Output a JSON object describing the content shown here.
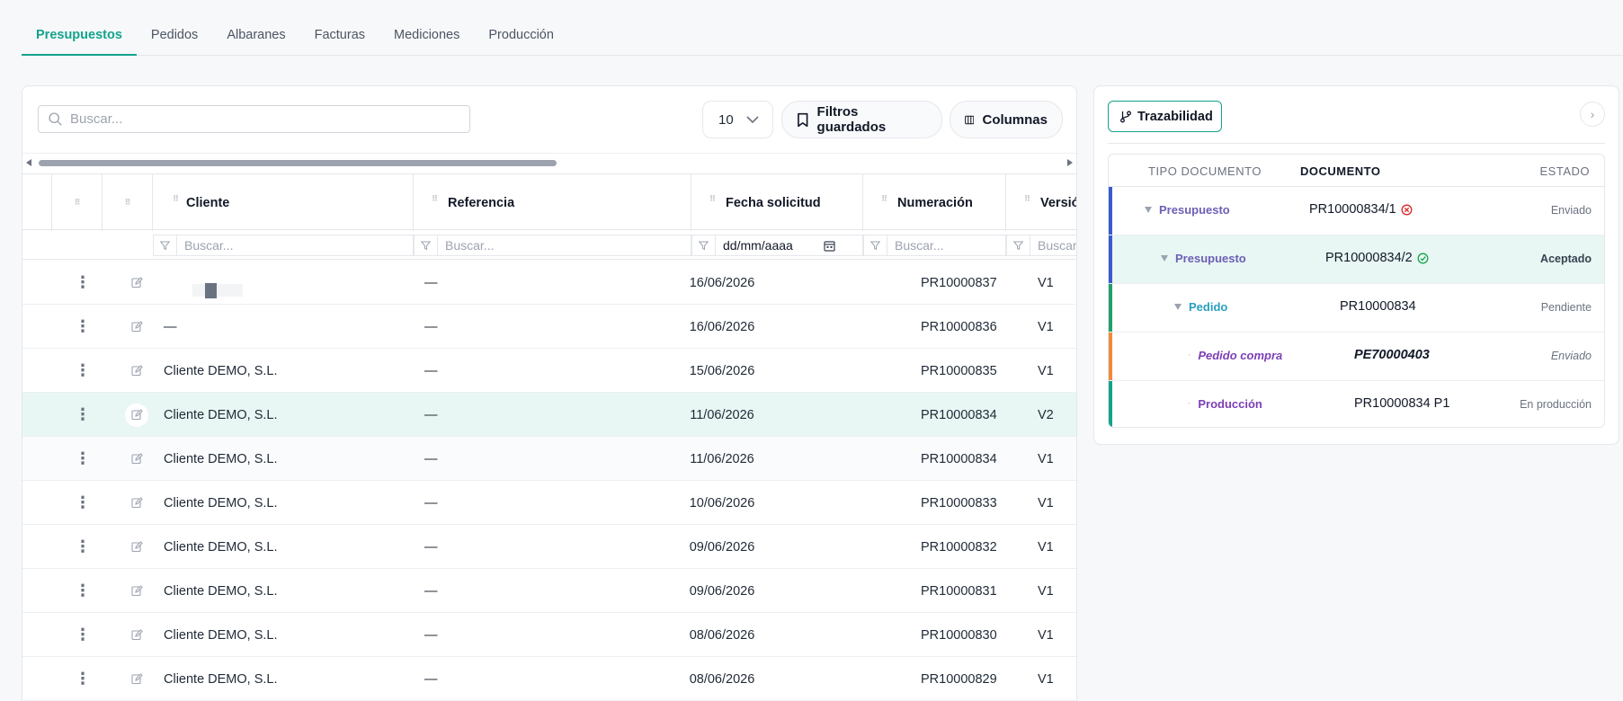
{
  "tabs": [
    {
      "label": "Presupuestos",
      "active": true
    },
    {
      "label": "Pedidos"
    },
    {
      "label": "Albaranes"
    },
    {
      "label": "Facturas"
    },
    {
      "label": "Mediciones"
    },
    {
      "label": "Producción"
    }
  ],
  "toolbar": {
    "search_placeholder": "Buscar...",
    "page_size": "10",
    "saved_filters_label": "Filtros guardados",
    "columns_label": "Columnas"
  },
  "table": {
    "headers": {
      "cliente": "Cliente",
      "referencia": "Referencia",
      "fecha": "Fecha solicitud",
      "numeracion": "Numeración",
      "version": "Versión"
    },
    "filters": {
      "cliente": "Buscar...",
      "referencia": "Buscar...",
      "fecha": "dd/mm/aaaa",
      "numeracion": "Buscar...",
      "version": "Buscar..."
    },
    "rows": [
      {
        "cliente": "",
        "referencia": "—",
        "fecha": "16/06/2026",
        "numeracion": "PR10000837",
        "version": "V1"
      },
      {
        "cliente": "—",
        "referencia": "—",
        "fecha": "16/06/2026",
        "numeracion": "PR10000836",
        "version": "V1"
      },
      {
        "cliente": "Cliente DEMO, S.L.",
        "referencia": "—",
        "fecha": "15/06/2026",
        "numeracion": "PR10000835",
        "version": "V1"
      },
      {
        "cliente": "Cliente DEMO, S.L.",
        "referencia": "—",
        "fecha": "11/06/2026",
        "numeracion": "PR10000834",
        "version": "V2",
        "selected": true
      },
      {
        "cliente": "Cliente DEMO, S.L.",
        "referencia": "—",
        "fecha": "11/06/2026",
        "numeracion": "PR10000834",
        "version": "V1"
      },
      {
        "cliente": "Cliente DEMO, S.L.",
        "referencia": "—",
        "fecha": "10/06/2026",
        "numeracion": "PR10000833",
        "version": "V1"
      },
      {
        "cliente": "Cliente DEMO, S.L.",
        "referencia": "—",
        "fecha": "09/06/2026",
        "numeracion": "PR10000832",
        "version": "V1"
      },
      {
        "cliente": "Cliente DEMO, S.L.",
        "referencia": "—",
        "fecha": "09/06/2026",
        "numeracion": "PR10000831",
        "version": "V1"
      },
      {
        "cliente": "Cliente DEMO, S.L.",
        "referencia": "—",
        "fecha": "08/06/2026",
        "numeracion": "PR10000830",
        "version": "V1"
      },
      {
        "cliente": "Cliente DEMO, S.L.",
        "referencia": "—",
        "fecha": "08/06/2026",
        "numeracion": "PR10000829",
        "version": "V1"
      }
    ]
  },
  "trazabilidad": {
    "button_label": "Trazabilidad",
    "headers": {
      "tipo": "TIPO DOCUMENTO",
      "documento": "DOCUMENTO",
      "estado": "ESTADO"
    },
    "rows": [
      {
        "tipo": "Presupuesto",
        "documento": "PR10000834/1",
        "estado": "Enviado",
        "status_icon": "x-circle-icon",
        "color": "#6d5fb5",
        "bar": "#3b5bcc"
      },
      {
        "tipo": "Presupuesto",
        "documento": "PR10000834/2",
        "estado": "Aceptado",
        "status_icon": "check-circle-icon",
        "color": "#6d5fb5",
        "bar": "#3b5bcc"
      },
      {
        "tipo": "Pedido",
        "documento": "PR10000834",
        "estado": "Pendiente",
        "color": "#2a9fc0",
        "bar": "#22a06b"
      },
      {
        "tipo": "Pedido compra",
        "documento": "PE70000403",
        "estado": "Enviado",
        "color": "#7c3fb5",
        "bar": "#ef8a3c"
      },
      {
        "tipo": "Producción",
        "documento": "PR10000834 P1",
        "estado": "En producción",
        "color": "#7c3fb5",
        "bar": "#14a38b"
      }
    ]
  },
  "colors": {
    "accent": "#14a38b",
    "selected_row": "#e8f7f3"
  }
}
